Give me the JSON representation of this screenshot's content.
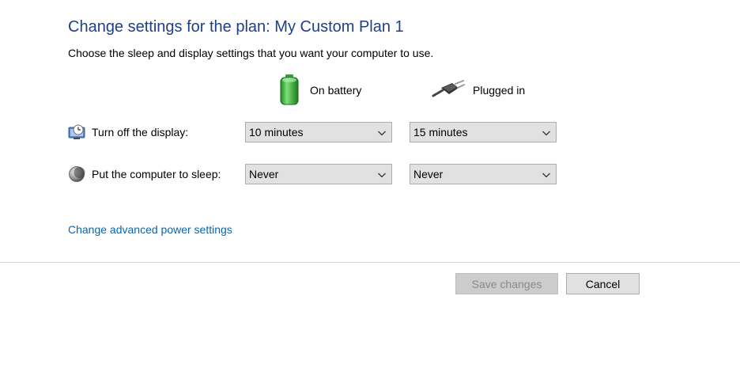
{
  "header": {
    "title": "Change settings for the plan: My Custom Plan 1",
    "subtitle": "Choose the sleep and display settings that you want your computer to use."
  },
  "columns": {
    "battery": {
      "label": "On battery",
      "icon": "battery-icon"
    },
    "plugged": {
      "label": "Plugged in",
      "icon": "power-plug-icon"
    }
  },
  "rows": {
    "display": {
      "label": "Turn off the display:",
      "icon": "monitor-clock-icon",
      "battery_value": "10 minutes",
      "plugged_value": "15 minutes"
    },
    "sleep": {
      "label": "Put the computer to sleep:",
      "icon": "moon-sleep-icon",
      "battery_value": "Never",
      "plugged_value": "Never"
    }
  },
  "advanced_link": "Change advanced power settings",
  "buttons": {
    "save": "Save changes",
    "cancel": "Cancel"
  },
  "colors": {
    "title": "#1e3f8a",
    "link": "#0a64ad",
    "battery_green": "#3cb43c",
    "select_bg": "#e1e1e1"
  }
}
